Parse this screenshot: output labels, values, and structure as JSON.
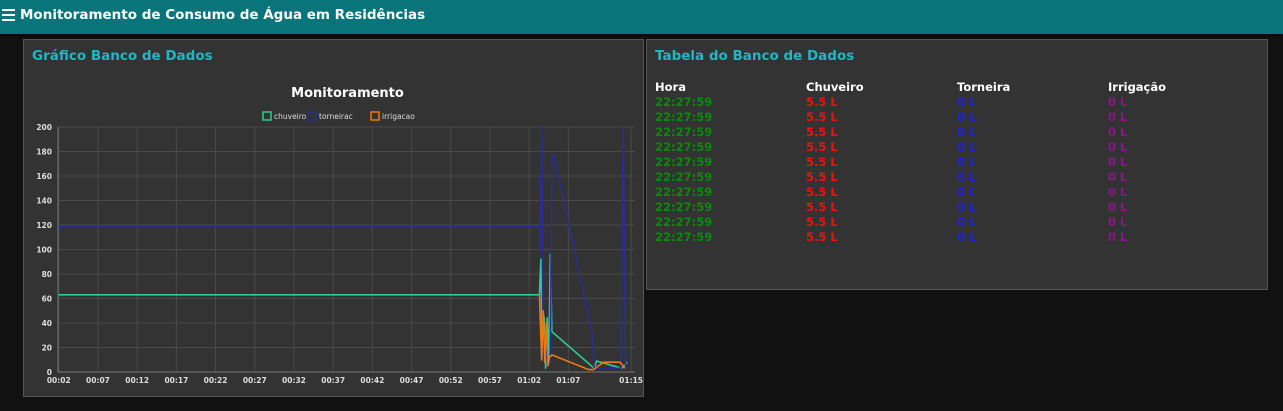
{
  "app": {
    "title": "Monitoramento de Consumo de Água em Residências",
    "header_color": "#097479"
  },
  "chart_card": {
    "title": "Gráfico Banco de Dados"
  },
  "table_card": {
    "title": "Tabela do Banco de Dados",
    "headers": [
      "Hora",
      "Chuveiro",
      "Torneira",
      "Irrigação"
    ],
    "rows": [
      [
        "22:27:59",
        "5.5 L",
        "0 L",
        "0 L"
      ],
      [
        "22:27:59",
        "5.5 L",
        "0 L",
        "0 L"
      ],
      [
        "22:27:59",
        "5.5 L",
        "0 L",
        "0 L"
      ],
      [
        "22:27:59",
        "5.5 L",
        "0 L",
        "0 L"
      ],
      [
        "22:27:59",
        "5.5 L",
        "0 L",
        "0 L"
      ],
      [
        "22:27:59",
        "5.5 L",
        "0 L",
        "0 L"
      ],
      [
        "22:27:59",
        "5.5 L",
        "0 L",
        "0 L"
      ],
      [
        "22:27:59",
        "5.5 L",
        "0 L",
        "0 L"
      ],
      [
        "22:27:59",
        "5.5 L",
        "0 L",
        "0 L"
      ],
      [
        "22:27:59",
        "5.5 L",
        "0 L",
        "0 L"
      ]
    ],
    "column_colors": [
      "#0b8a0b",
      "#ee1111",
      "#1a22e0",
      "#8a158a"
    ]
  },
  "chart_data": {
    "type": "line",
    "title": "Monitoramento",
    "xlabel": "",
    "ylabel": "",
    "ylim": [
      0,
      200
    ],
    "xlim": [
      1.9,
      75.5
    ],
    "x_ticks": [
      "00:02",
      "00:07",
      "00:12",
      "00:17",
      "00:22",
      "00:27",
      "00:32",
      "00:37",
      "00:42",
      "00:47",
      "00:52",
      "00:57",
      "01:02",
      "01:07",
      "01:15"
    ],
    "x_tick_values": [
      2,
      7,
      12,
      17,
      22,
      27,
      32,
      37,
      42,
      47,
      52,
      57,
      62,
      67,
      75
    ],
    "y_ticks": [
      0,
      20,
      40,
      60,
      80,
      100,
      120,
      140,
      160,
      180,
      200
    ],
    "grid": true,
    "legend_position": "top-center",
    "series": [
      {
        "name": "chuveiro",
        "color": "#2ecc8f",
        "points": [
          [
            2,
            63
          ],
          [
            63.3,
            63
          ],
          [
            63.5,
            92
          ],
          [
            63.7,
            10
          ],
          [
            63.9,
            45
          ],
          [
            64.1,
            3
          ],
          [
            64.3,
            44
          ],
          [
            64.5,
            8
          ],
          [
            64.7,
            96
          ],
          [
            64.9,
            33
          ],
          [
            70.3,
            3
          ],
          [
            70.6,
            9
          ],
          [
            73.8,
            3
          ],
          [
            74.5,
            8
          ]
        ]
      },
      {
        "name": "torneirac",
        "color": "#2b2e8f",
        "points": [
          [
            2,
            119
          ],
          [
            63.3,
            119
          ],
          [
            63.4,
            100
          ],
          [
            63.6,
            200
          ],
          [
            63.8,
            10
          ],
          [
            64.0,
            30
          ],
          [
            64.3,
            8
          ],
          [
            64.7,
            10
          ],
          [
            64.9,
            175
          ],
          [
            65.1,
            178
          ],
          [
            70.0,
            33
          ],
          [
            70.3,
            3
          ],
          [
            73.7,
            3
          ],
          [
            74.0,
            200
          ],
          [
            74.3,
            3
          ]
        ]
      },
      {
        "name": "irrigacao",
        "color": "#ee7711",
        "points": [
          [
            63.3,
            63
          ],
          [
            63.6,
            10
          ],
          [
            63.8,
            50
          ],
          [
            64.0,
            8
          ],
          [
            64.2,
            40
          ],
          [
            64.4,
            5
          ],
          [
            64.6,
            12
          ],
          [
            64.9,
            14
          ],
          [
            69.6,
            2
          ],
          [
            70.2,
            2
          ],
          [
            71.5,
            8
          ],
          [
            73.6,
            8
          ],
          [
            74.2,
            3
          ]
        ]
      }
    ]
  }
}
